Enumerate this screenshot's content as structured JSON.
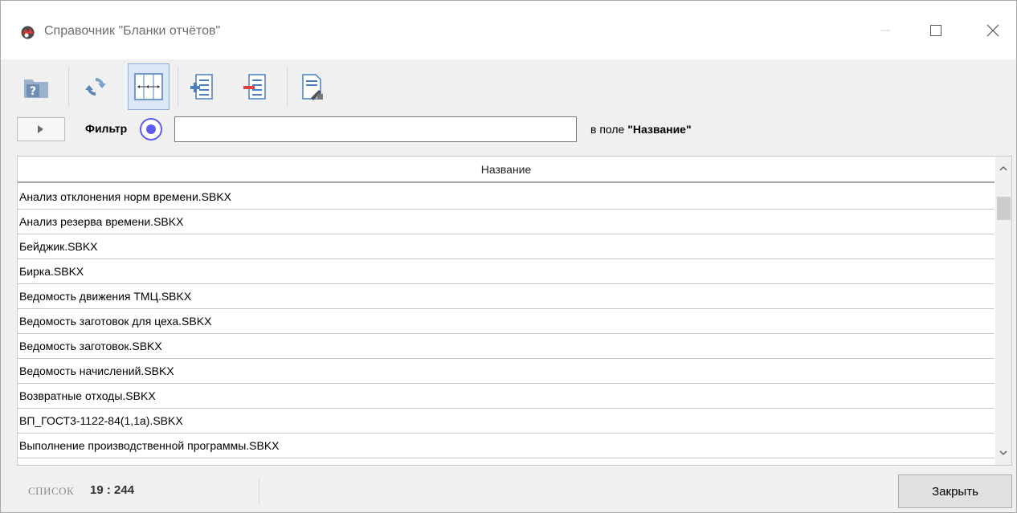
{
  "window": {
    "title": "Справочник \"Бланки отчётов\"",
    "controls": [
      "minimize",
      "maximize",
      "close"
    ]
  },
  "toolbar": {
    "buttons": [
      {
        "icon": "help-folder-icon"
      },
      {
        "icon": "refresh-icon"
      },
      {
        "icon": "fit-columns-icon",
        "pressed": true
      },
      {
        "icon": "add-record-icon"
      },
      {
        "icon": "delete-record-icon"
      },
      {
        "icon": "edit-record-icon"
      }
    ]
  },
  "filter": {
    "label": "Фильтр",
    "value": "",
    "field_prefix": "в поле ",
    "field_name": "\"Название\""
  },
  "grid": {
    "column_header": "Название",
    "rows": [
      "Анализ отклонения норм времени.SBKX",
      "Анализ резерва времени.SBKX",
      "Бейджик.SBKX",
      "Бирка.SBKX",
      "Ведомость движения ТМЦ.SBKX",
      "Ведомость заготовок для цеха.SBKX",
      "Ведомость заготовок.SBKX",
      "Ведомость начислений.SBKX",
      "Возвратные отходы.SBKX",
      "ВП_ГОСТ3-1122-84(1,1а).SBKX",
      "Выполнение производственной программы.SBKX"
    ]
  },
  "status": {
    "mode": "СПИСОК",
    "count": "19 : 244",
    "close_label": "Закрыть"
  },
  "colors": {
    "accent_radio": "#5b5bf0",
    "pressed_button_bg": "#dbe7f5",
    "toolbar_icon_blue": "#4a7fc1",
    "toolbar_icon_red": "#e04040"
  }
}
